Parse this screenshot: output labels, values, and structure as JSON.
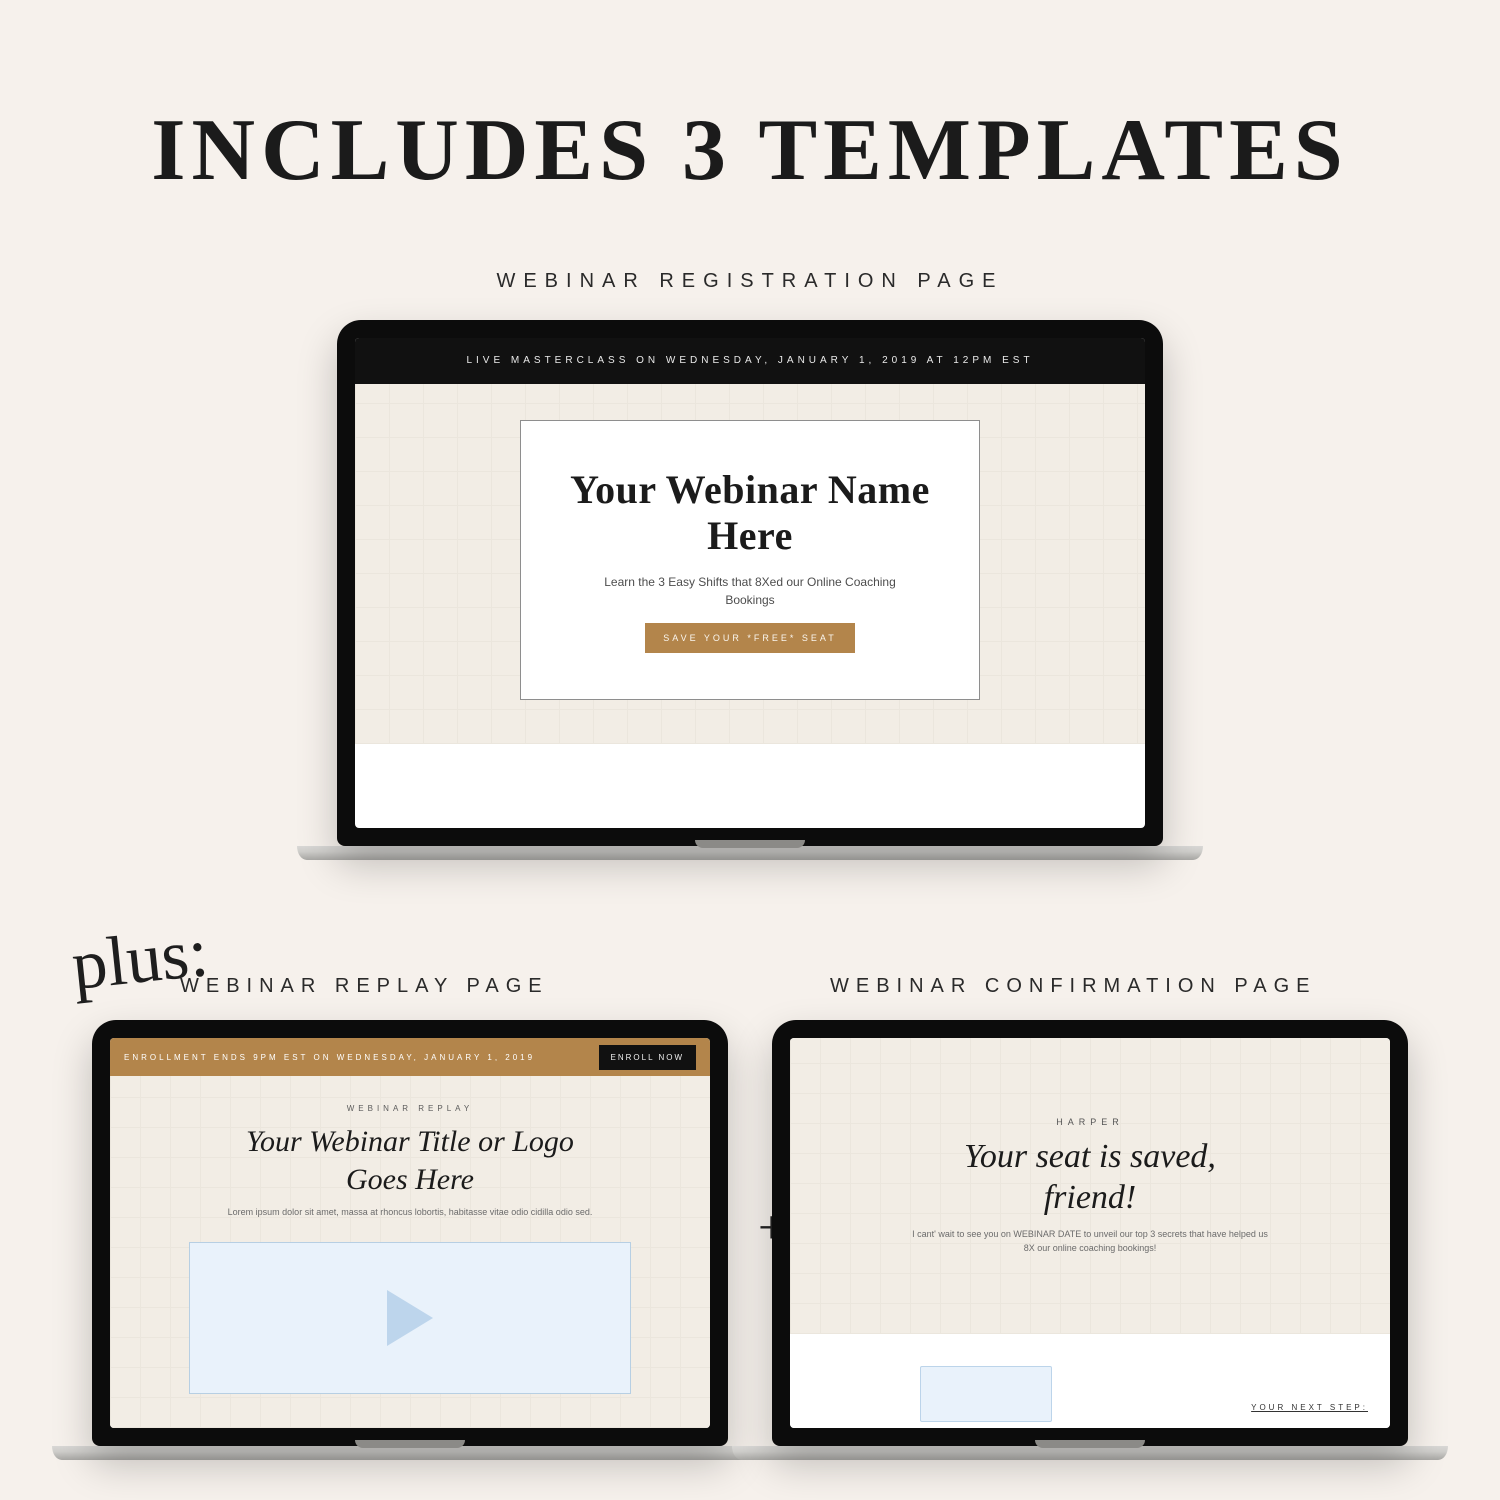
{
  "title": "INCLUDES 3 TEMPLATES",
  "plus_script": "plus:",
  "plus_mark": "+",
  "sections": {
    "a": {
      "label": "WEBINAR REGISTRATION PAGE"
    },
    "b": {
      "label": "WEBINAR REPLAY PAGE"
    },
    "c": {
      "label": "WEBINAR CONFIRMATION PAGE"
    }
  },
  "laptop_a": {
    "topbar": "LIVE MASTERCLASS ON WEDNESDAY, JANUARY 1, 2019 AT 12PM EST",
    "headline": "Your Webinar Name Here",
    "sub": "Learn the 3 Easy Shifts that 8Xed our Online Coaching Bookings",
    "cta": "SAVE YOUR *FREE* SEAT"
  },
  "laptop_b": {
    "bar_caption": "ENROLLMENT ENDS 9PM EST ON WEDNESDAY, JANUARY 1, 2019",
    "bar_btn": "ENROLL NOW",
    "eyebrow": "WEBINAR REPLAY",
    "title": "Your Webinar Title or Logo Goes Here",
    "sub": "Lorem ipsum dolor sit amet, massa at rhoncus lobortis, habitasse vitae odio cidilla odio sed."
  },
  "laptop_c": {
    "eyebrow": "HARPER",
    "title": "Your seat is saved, friend!",
    "sub": "I cant' wait to see you on WEBINAR DATE to unveil our top 3 secrets that have helped us 8X our online coaching bookings!",
    "next": "YOUR NEXT STEP:"
  },
  "colors": {
    "page_bg": "#f6f1ec",
    "ink": "#1b1b1b",
    "accent": "#b3854b",
    "cream": "#f2ede5",
    "paleblue": "#e9f2fb"
  }
}
